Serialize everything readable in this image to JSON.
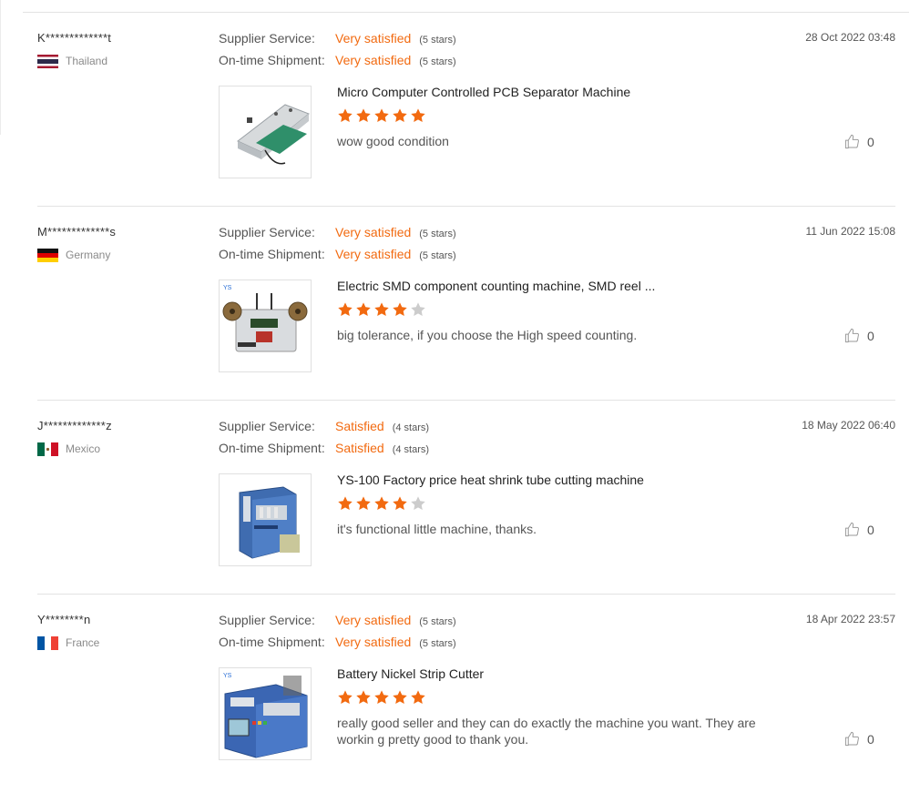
{
  "reviews": [
    {
      "buyer": "K*************t",
      "country": "Thailand",
      "flag": "thailand-flag-icon",
      "supplier_service_label": "Supplier Service:",
      "supplier_service_value": "Very satisfied",
      "supplier_service_stars": "(5 stars)",
      "shipment_label": "On-time Shipment:",
      "shipment_value": "Very satisfied",
      "shipment_stars": "(5 stars)",
      "date": "28 Oct 2022 03:48",
      "product": "Micro Computer Controlled PCB Separator Machine",
      "rating": 5,
      "comment": "wow good condition",
      "likes": "0"
    },
    {
      "buyer": "M*************s",
      "country": "Germany",
      "flag": "germany-flag-icon",
      "supplier_service_label": "Supplier Service:",
      "supplier_service_value": "Very satisfied",
      "supplier_service_stars": "(5 stars)",
      "shipment_label": "On-time Shipment:",
      "shipment_value": "Very satisfied",
      "shipment_stars": "(5 stars)",
      "date": "11 Jun 2022 15:08",
      "product": "Electric SMD component counting machine, SMD reel ...",
      "rating": 4,
      "comment": "big tolerance, if you choose the High speed counting.",
      "likes": "0"
    },
    {
      "buyer": "J*************z",
      "country": "Mexico",
      "flag": "mexico-flag-icon",
      "supplier_service_label": "Supplier Service:",
      "supplier_service_value": "Satisfied",
      "supplier_service_stars": "(4 stars)",
      "shipment_label": "On-time Shipment:",
      "shipment_value": "Satisfied",
      "shipment_stars": "(4 stars)",
      "date": "18 May 2022 06:40",
      "product": "YS-100 Factory price heat shrink tube cutting machine",
      "rating": 4,
      "comment": "it's functional little machine, thanks.",
      "likes": "0"
    },
    {
      "buyer": "Y********n",
      "country": "France",
      "flag": "france-flag-icon",
      "supplier_service_label": "Supplier Service:",
      "supplier_service_value": "Very satisfied",
      "supplier_service_stars": "(5 stars)",
      "shipment_label": "On-time Shipment:",
      "shipment_value": "Very satisfied",
      "shipment_stars": "(5 stars)",
      "date": "18 Apr 2022 23:57",
      "product": "Battery Nickel Strip Cutter",
      "rating": 5,
      "comment": "really good seller and they can do exactly the machine you want. They are workin g pretty good to thank you.",
      "likes": "0"
    }
  ],
  "colors": {
    "accent": "#f26a10",
    "star_filled": "#f26a10",
    "star_empty": "#cccccc",
    "separator": "#e3e3e3"
  }
}
